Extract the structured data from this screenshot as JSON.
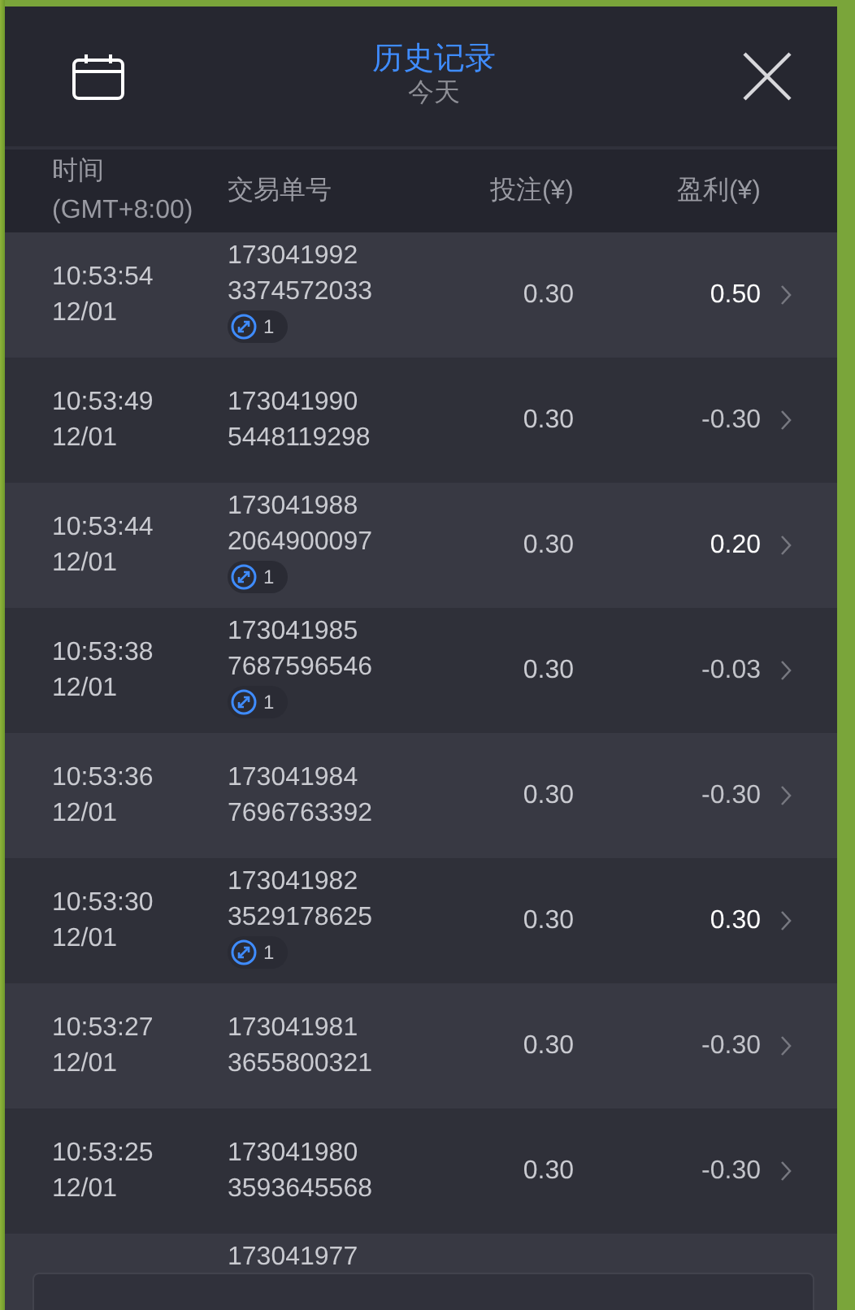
{
  "header": {
    "title": "历史记录",
    "subtitle": "今天"
  },
  "columns": {
    "time_line_1": "时间",
    "time_line_2": "(GMT+8:00)",
    "order": "交易单号",
    "bet": "投注(¥)",
    "profit": "盈利(¥)"
  },
  "rows": [
    {
      "time": "10:53:54",
      "date": "12/01",
      "order_line_1": "173041992",
      "order_line_2": "3374572033",
      "badge": "1",
      "bet": "0.30",
      "profit": "0.50",
      "emphasized": true
    },
    {
      "time": "10:53:49",
      "date": "12/01",
      "order_line_1": "173041990",
      "order_line_2": "5448119298",
      "bet": "0.30",
      "profit": "-0.30",
      "emphasized": false
    },
    {
      "time": "10:53:44",
      "date": "12/01",
      "order_line_1": "173041988",
      "order_line_2": "2064900097",
      "badge": "1",
      "bet": "0.30",
      "profit": "0.20",
      "emphasized": true
    },
    {
      "time": "10:53:38",
      "date": "12/01",
      "order_line_1": "173041985",
      "order_line_2": "7687596546",
      "badge": "1",
      "bet": "0.30",
      "profit": "-0.03",
      "emphasized": false
    },
    {
      "time": "10:53:36",
      "date": "12/01",
      "order_line_1": "173041984",
      "order_line_2": "7696763392",
      "bet": "0.30",
      "profit": "-0.30",
      "emphasized": false
    },
    {
      "time": "10:53:30",
      "date": "12/01",
      "order_line_1": "173041982",
      "order_line_2": "3529178625",
      "badge": "1",
      "bet": "0.30",
      "profit": "0.30",
      "emphasized": true
    },
    {
      "time": "10:53:27",
      "date": "12/01",
      "order_line_1": "173041981",
      "order_line_2": "3655800321",
      "bet": "0.30",
      "profit": "-0.30",
      "emphasized": false
    },
    {
      "time": "10:53:25",
      "date": "12/01",
      "order_line_1": "173041980",
      "order_line_2": "3593645568",
      "bet": "0.30",
      "profit": "-0.30",
      "emphasized": false
    },
    {
      "order_line_1": "173041977"
    }
  ]
}
